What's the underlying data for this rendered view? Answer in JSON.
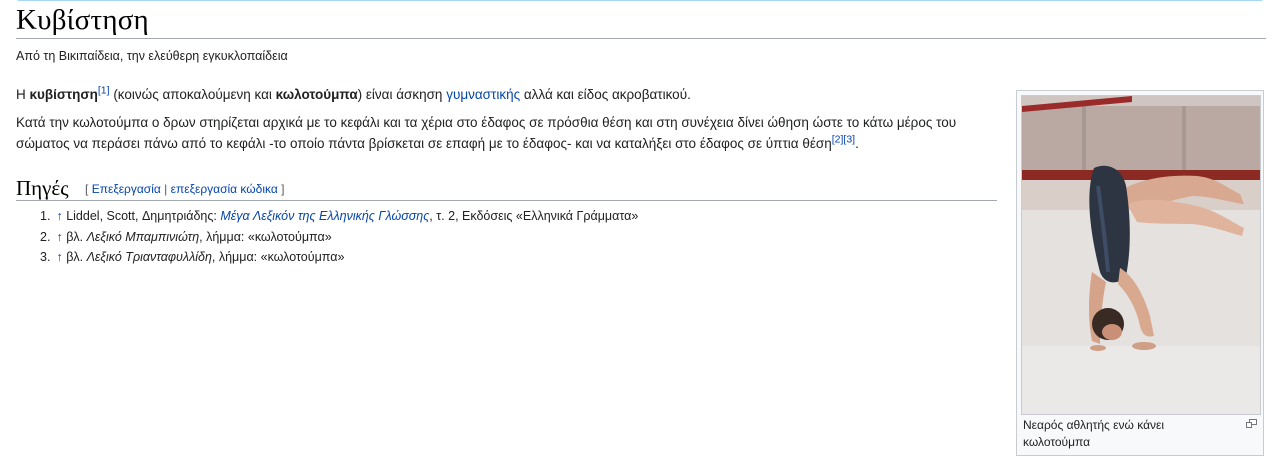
{
  "page": {
    "title": "Κυβίστηση",
    "tagline": "Από τη Βικιπαίδεια, την ελεύθερη εγκυκλοπαίδεια"
  },
  "intro": {
    "p1_a": "Η ",
    "p1_term": "κυβίστηση",
    "p1_ref1": "[1]",
    "p1_b": " (κοινώς αποκαλούμενη και ",
    "p1_alt": "κωλοτούμπα",
    "p1_c": ") είναι άσκηση ",
    "p1_link": "γυμναστικής",
    "p1_d": " αλλά και είδος ακροβατικού.",
    "p2_a": "Κατά την κωλοτούμπα ο δρων στηρίζεται αρχικά με το κεφάλι και τα χέρια στο έδαφος σε πρόσθια θέση και στη συνέχεια δίνει ώθηση ώστε το κάτω μέρος του σώματος να περάσει πάνω από το κεφάλι -το οποίο πάντα βρίσκεται σε επαφή με το έδαφος- και να καταλήξει στο έδαφος σε ύπτια θέση",
    "p2_ref2": "[2]",
    "p2_ref3": "[3]",
    "p2_end": "."
  },
  "sources": {
    "heading": "Πηγές",
    "edit_open": "[ ",
    "edit_link": "Επεξεργασία",
    "edit_sep": " | ",
    "edit_code_link": "επεξεργασία κώδικα",
    "edit_close": " ]",
    "refs": [
      {
        "num": "1.",
        "arrow": "↑",
        "pre": " Liddel, Scott, Δημητριάδης: ",
        "ital": "Μέγα Λεξικόν της Ελληνικής Γλώσσης",
        "post": ", τ. 2, Εκδόσεις «Ελληνικά Γράμματα»"
      },
      {
        "num": "2.",
        "arrow": "↑",
        "pre": " βλ. ",
        "ital": "Λεξικό Μπαμπινιώτη",
        "post": ", λήμμα: «κωλοτούμπα»"
      },
      {
        "num": "3.",
        "arrow": "↑",
        "pre": " βλ. ",
        "ital": "Λεξικό Τριανταφυλλίδη",
        "post": ", λήμμα: «κωλοτούμπα»"
      }
    ]
  },
  "thumbnail": {
    "caption": "Νεαρός αθλητής ενώ κάνει κωλοτούμπα",
    "icon": "magnify-icon"
  },
  "colors": {
    "link": "#0645ad",
    "rule": "#a2a9b1"
  }
}
